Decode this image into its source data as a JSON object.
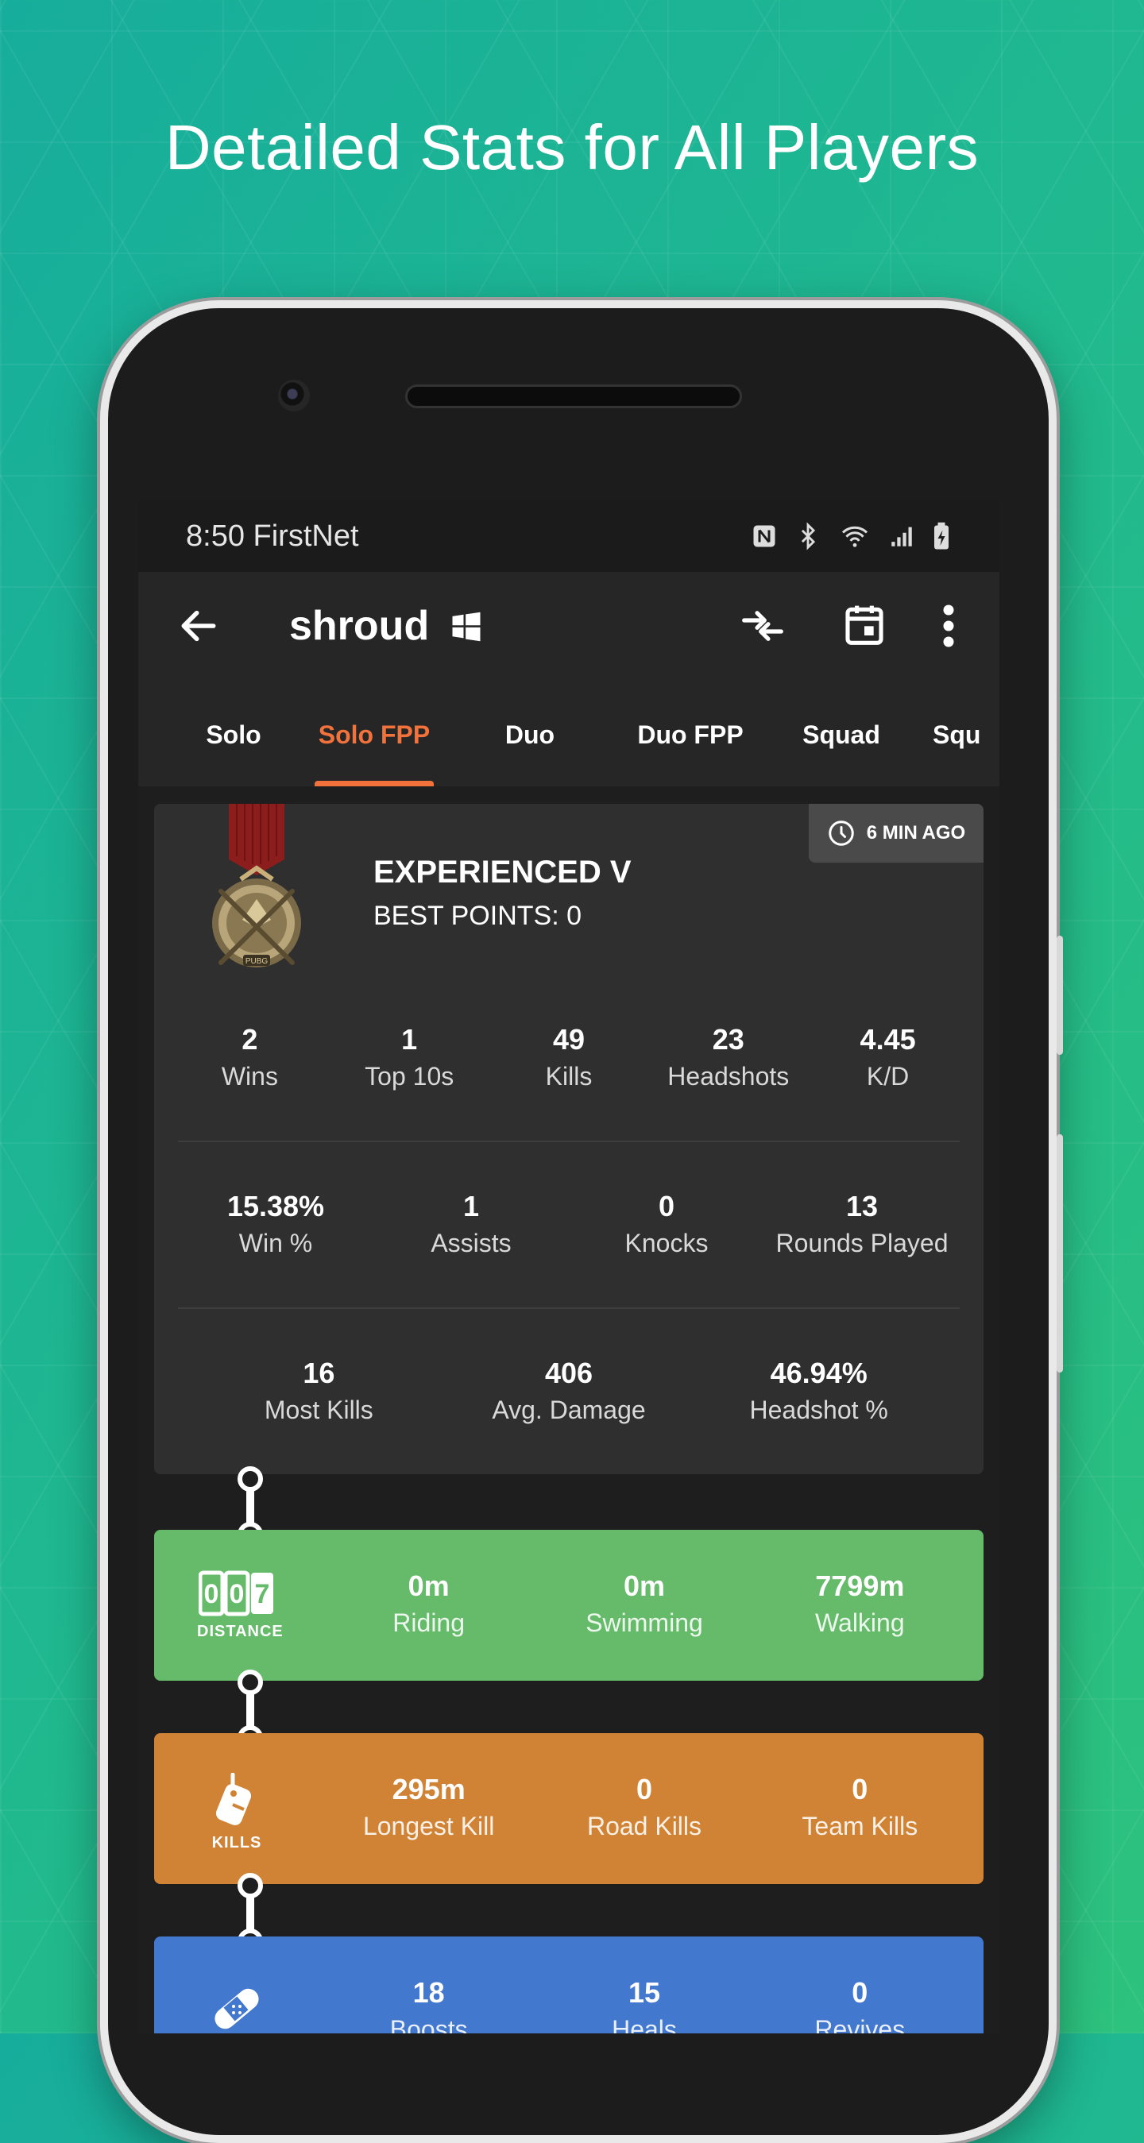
{
  "headline": "Detailed Stats for All Players",
  "status_bar": {
    "time": "8:50 FirstNet"
  },
  "appbar": {
    "title": "shroud"
  },
  "tabs": [
    {
      "label": "Solo",
      "active": false
    },
    {
      "label": "Solo FPP",
      "active": true
    },
    {
      "label": "Duo",
      "active": false
    },
    {
      "label": "Duo FPP",
      "active": false
    },
    {
      "label": "Squad",
      "active": false
    },
    {
      "label": "Squ",
      "active": false
    }
  ],
  "overview": {
    "updated": "6 MIN AGO",
    "rank": "EXPERIENCED V",
    "best_points": "BEST POINTS: 0",
    "medal_text": "PUBG",
    "row1": [
      {
        "value": "2",
        "label": "Wins"
      },
      {
        "value": "1",
        "label": "Top 10s"
      },
      {
        "value": "49",
        "label": "Kills"
      },
      {
        "value": "23",
        "label": "Headshots"
      },
      {
        "value": "4.45",
        "label": "K/D"
      }
    ],
    "row2": [
      {
        "value": "15.38%",
        "label": "Win %"
      },
      {
        "value": "1",
        "label": "Assists"
      },
      {
        "value": "0",
        "label": "Knocks"
      },
      {
        "value": "13",
        "label": "Rounds Played"
      }
    ],
    "row3": [
      {
        "value": "16",
        "label": "Most Kills"
      },
      {
        "value": "406",
        "label": "Avg. Damage"
      },
      {
        "value": "46.94%",
        "label": "Headshot %"
      }
    ]
  },
  "distance": {
    "label": "DISTANCE",
    "odometer": "007",
    "color": "#66bb6a",
    "stats": [
      {
        "value": "0m",
        "label": "Riding"
      },
      {
        "value": "0m",
        "label": "Swimming"
      },
      {
        "value": "7799m",
        "label": "Walking"
      }
    ]
  },
  "kills": {
    "label": "KILLS",
    "color": "#d08334",
    "stats": [
      {
        "value": "295m",
        "label": "Longest Kill"
      },
      {
        "value": "0",
        "label": "Road Kills"
      },
      {
        "value": "0",
        "label": "Team Kills"
      }
    ]
  },
  "support": {
    "color": "#4378cf",
    "stats": [
      {
        "value": "18",
        "label": "Boosts"
      },
      {
        "value": "15",
        "label": "Heals"
      },
      {
        "value": "0",
        "label": "Revives"
      }
    ]
  },
  "colors": {
    "accent": "#f2723c",
    "background_dark": "#1e1e1e",
    "card": "#2f2f2f"
  },
  "icons": [
    "back-arrow-icon",
    "windows-icon",
    "compare-icon",
    "calendar-icon",
    "more-vert-icon",
    "clock-icon",
    "medal-icon",
    "odometer-icon",
    "dog-tag-icon",
    "bandage-icon"
  ]
}
